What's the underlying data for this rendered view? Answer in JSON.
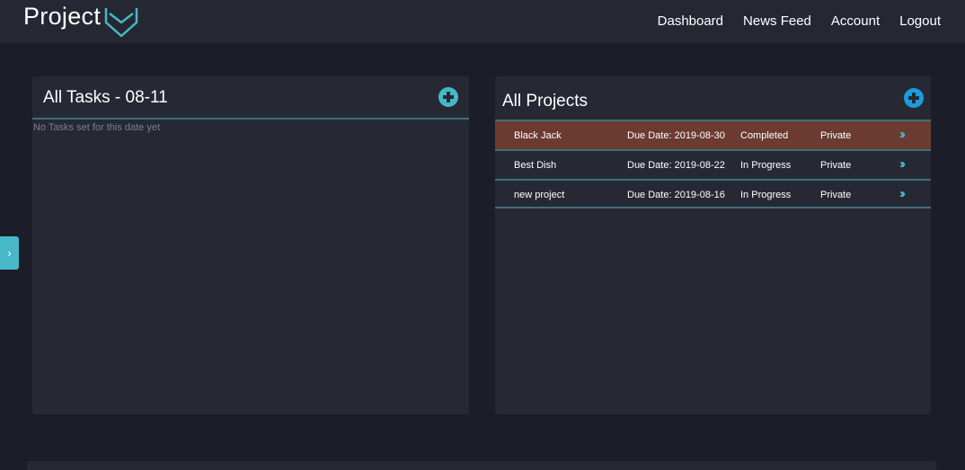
{
  "colors": {
    "accent": "#48b7c7",
    "accent_blue": "#1a9be0",
    "highlight_row": "#6b3b32",
    "background": "#1b1e28",
    "panel": "#262934"
  },
  "navbar": {
    "brand": "Project",
    "links": [
      "Dashboard",
      "News Feed",
      "Account",
      "Logout"
    ]
  },
  "tasks": {
    "title": "All Tasks - 08-11",
    "empty_message": "No Tasks set for this date yet"
  },
  "projects": {
    "title": "All Projects",
    "rows": [
      {
        "name": "Black Jack",
        "due": "Due Date: 2019-08-30",
        "status": "Completed",
        "privacy": "Private"
      },
      {
        "name": "Best Dish",
        "due": "Due Date: 2019-08-22",
        "status": "In Progress",
        "privacy": "Private"
      },
      {
        "name": "new project",
        "due": "Due Date: 2019-08-16",
        "status": "In Progress",
        "privacy": "Private"
      }
    ]
  },
  "sidebar_toggle": {
    "glyph": "›"
  },
  "icons": {
    "logo": "shield-logo-icon",
    "add": "plus-circle-icon",
    "open": "double-chevron-right-icon",
    "toggle": "chevron-right-icon"
  }
}
